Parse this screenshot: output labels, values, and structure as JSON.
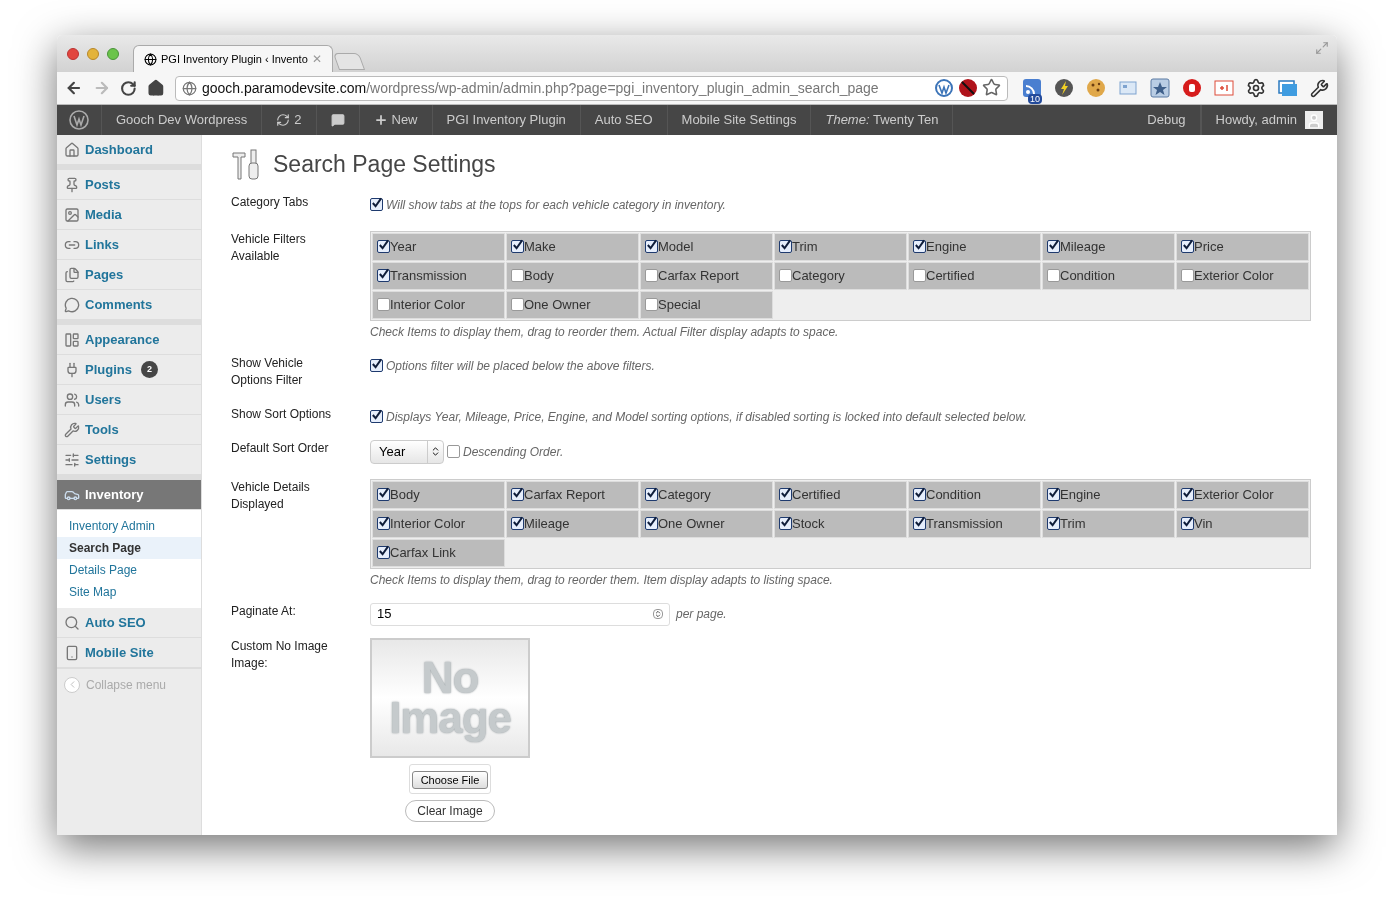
{
  "browser": {
    "tabs": [
      {
        "title": "PGI Inventory Plugin ‹ Invento",
        "selected": true,
        "close": "✕"
      }
    ],
    "url_host": "gooch.paramodevsite.com",
    "url_path": "/wordpress/wp-admin/admin.php?page=pgi_inventory_plugin_admin_search_page",
    "extension_badge": "10"
  },
  "admin_bar": {
    "left": [
      {
        "kind": "logo"
      },
      {
        "kind": "text",
        "label": "Gooch Dev Wordpress"
      },
      {
        "kind": "updates",
        "label": "2"
      },
      {
        "kind": "comments"
      },
      {
        "kind": "new",
        "label": "New"
      },
      {
        "kind": "text",
        "label": "PGI Inventory Plugin"
      },
      {
        "kind": "text",
        "label": "Auto SEO"
      },
      {
        "kind": "text",
        "label": "Mobile Site Settings"
      },
      {
        "kind": "text",
        "label": "*Theme:* Twenty Ten"
      }
    ],
    "right": [
      {
        "kind": "text",
        "label": "Debug"
      },
      {
        "kind": "account",
        "label": "Howdy, admin"
      }
    ]
  },
  "sidebar": {
    "groups": [
      [
        {
          "label": "Dashboard",
          "selected": false
        }
      ],
      [
        {
          "label": "Posts",
          "selected": false
        },
        {
          "label": "Media",
          "selected": false
        },
        {
          "label": "Links",
          "selected": false
        },
        {
          "label": "Pages",
          "selected": false
        },
        {
          "label": "Comments",
          "selected": false
        }
      ],
      [
        {
          "label": "Appearance",
          "selected": false
        },
        {
          "label": "Plugins",
          "badge": "2",
          "selected": false
        },
        {
          "label": "Users",
          "selected": false
        },
        {
          "label": "Tools",
          "selected": false
        },
        {
          "label": "Settings",
          "selected": false
        }
      ],
      [
        {
          "label": "Inventory",
          "selected": true,
          "children": [
            {
              "label": "Inventory Admin",
              "selected": false
            },
            {
              "label": "Search Page",
              "selected": true
            },
            {
              "label": "Details Page",
              "selected": false
            },
            {
              "label": "Site Map",
              "selected": false
            }
          ]
        },
        {
          "label": "Auto SEO",
          "selected": false
        },
        {
          "label": "Mobile Site",
          "selected": false
        }
      ]
    ],
    "collapse": "Collapse menu"
  },
  "page": {
    "title": "Search Page Settings",
    "settings": [
      {
        "kind": "checkbox",
        "label": "Category Tabs",
        "checked": true,
        "description": "Will show tabs at the tops for each vehicle category in inventory."
      },
      {
        "kind": "grid",
        "label": "Vehicle Filters Available",
        "note": "Check Items to display them, drag to reorder them. Actual Filter display adapts to space.",
        "options": [
          {
            "label": "Year",
            "checked": true
          },
          {
            "label": "Make",
            "checked": true
          },
          {
            "label": "Model",
            "checked": true
          },
          {
            "label": "Trim",
            "checked": true
          },
          {
            "label": "Engine",
            "checked": true
          },
          {
            "label": "Mileage",
            "checked": true
          },
          {
            "label": "Price",
            "checked": true
          },
          {
            "label": "Transmission",
            "checked": true
          },
          {
            "label": "Body",
            "checked": false
          },
          {
            "label": "Carfax Report",
            "checked": false
          },
          {
            "label": "Category",
            "checked": false
          },
          {
            "label": "Certified",
            "checked": false
          },
          {
            "label": "Condition",
            "checked": false
          },
          {
            "label": "Exterior Color",
            "checked": false
          },
          {
            "label": "Interior Color",
            "checked": false
          },
          {
            "label": "One Owner",
            "checked": false
          },
          {
            "label": "Special",
            "checked": false
          }
        ]
      },
      {
        "kind": "checkbox",
        "label": "Show Vehicle Options Filter",
        "checked": true,
        "description": "Options filter will be placed below the above filters."
      },
      {
        "kind": "checkbox",
        "label": "Show Sort Options",
        "checked": true,
        "description": "Displays Year, Mileage, Price, Engine, and Model sorting options, if disabled sorting is locked into default selected below."
      },
      {
        "kind": "select",
        "label": "Default Sort Order",
        "value": "Year",
        "checked": false,
        "description": "Descending Order."
      },
      {
        "kind": "grid",
        "label": "Vehicle Details Displayed",
        "note": "Check Items to display them, drag to reorder them. Item display adapts to listing space.",
        "options": [
          {
            "label": "Body",
            "checked": true
          },
          {
            "label": "Carfax Report",
            "checked": true
          },
          {
            "label": "Category",
            "checked": true
          },
          {
            "label": "Certified",
            "checked": true
          },
          {
            "label": "Condition",
            "checked": true
          },
          {
            "label": "Engine",
            "checked": true
          },
          {
            "label": "Exterior Color",
            "checked": true
          },
          {
            "label": "Interior Color",
            "checked": true
          },
          {
            "label": "Mileage",
            "checked": true
          },
          {
            "label": "One Owner",
            "checked": true
          },
          {
            "label": "Stock",
            "checked": true
          },
          {
            "label": "Transmission",
            "checked": true
          },
          {
            "label": "Trim",
            "checked": true
          },
          {
            "label": "Vin",
            "checked": true
          },
          {
            "label": "Carfax Link",
            "checked": true
          }
        ]
      },
      {
        "kind": "number",
        "label": "Paginate At:",
        "value": "15",
        "suffix": "per page."
      },
      {
        "kind": "image",
        "label": "Custom No Image Image:",
        "preview_lines": [
          "No",
          "Image"
        ],
        "buttons": [
          "Choose File",
          "Clear Image"
        ]
      }
    ]
  }
}
